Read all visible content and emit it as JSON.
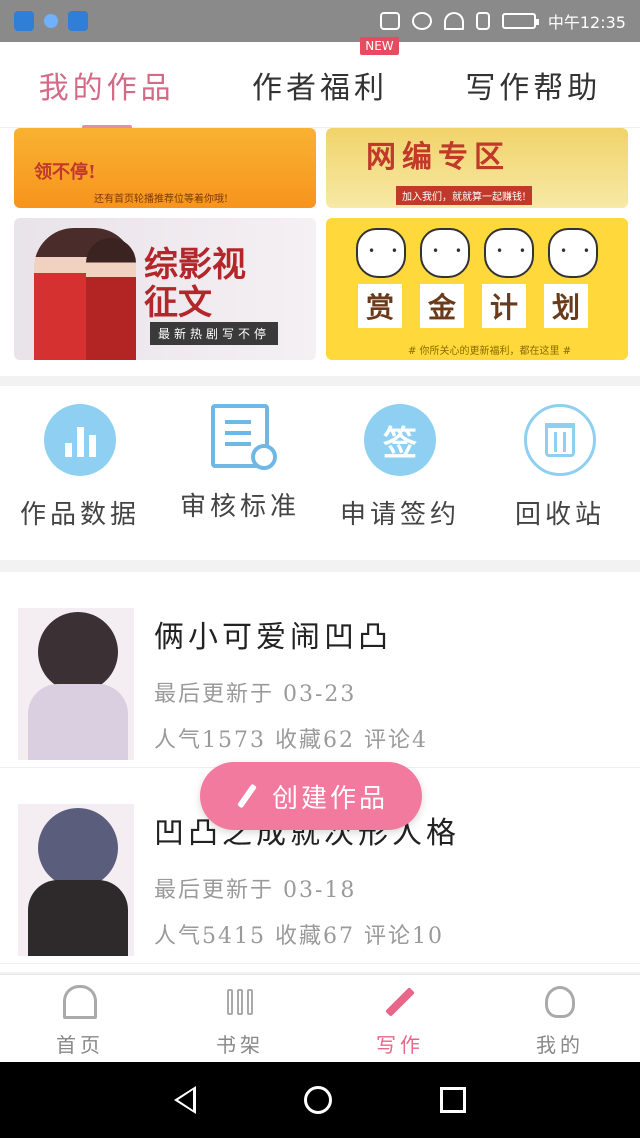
{
  "status_bar": {
    "time": "中午12:35"
  },
  "top_tabs": [
    {
      "label": "我的作品",
      "active": true
    },
    {
      "label": "作者福利",
      "badge": "NEW"
    },
    {
      "label": "写作帮助"
    }
  ],
  "banners": {
    "b1": {
      "main": "领不停!",
      "sub": "还有首页轮播推荐位等着你哦!"
    },
    "b2": {
      "main": "网编专区",
      "sub": "加入我们，就就算一起赚钱!"
    },
    "b3": {
      "main": "综影视\n征文",
      "sub": "最新热剧写不停"
    },
    "b4": {
      "words": [
        "赏",
        "金",
        "计",
        "划"
      ],
      "sub": "# 你所关心的更新福利，都在这里 #"
    }
  },
  "features": [
    {
      "label": "作品数据",
      "icon": "chart-icon"
    },
    {
      "label": "审核标准",
      "icon": "document-icon"
    },
    {
      "label": "申请签约",
      "icon": "sign-icon",
      "glyph": "签"
    },
    {
      "label": "回收站",
      "icon": "trash-icon"
    }
  ],
  "works": [
    {
      "title": "俩小可爱闹凹凸",
      "updated": "最后更新于 03-23",
      "stats": "人气1573 收藏62 评论4"
    },
    {
      "title": "凹凸之成就次形人格",
      "updated": "最后更新于 03-18",
      "stats": "人气5415 收藏67 评论10"
    }
  ],
  "create_button": {
    "label": "创建作品"
  },
  "bottom_nav": [
    {
      "label": "首页",
      "icon": "home-icon"
    },
    {
      "label": "书架",
      "icon": "bookshelf-icon"
    },
    {
      "label": "写作",
      "icon": "pen-icon",
      "active": true
    },
    {
      "label": "我的",
      "icon": "profile-icon"
    }
  ],
  "colors": {
    "accent": "#e8668a",
    "light_blue": "#8fd0f2",
    "create_button": "#f27a9e"
  }
}
